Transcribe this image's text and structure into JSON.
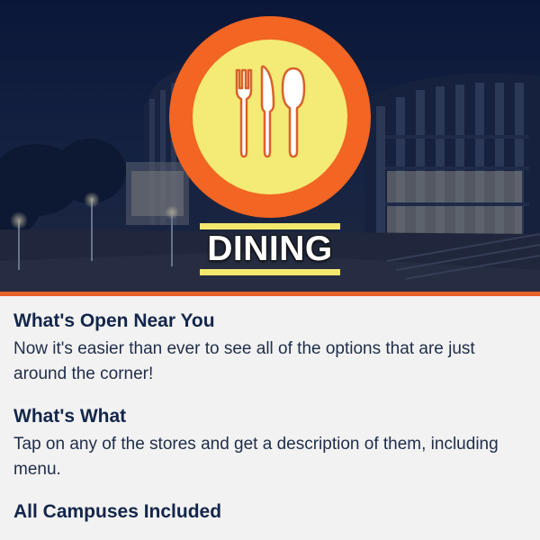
{
  "hero": {
    "title": "DINING",
    "logo_icon": "fork-knife-spoon-icon",
    "colors": {
      "ring": "#f26522",
      "disc": "#f4ea76",
      "title_bar": "#f2e86d",
      "accent_line": "#e8622a"
    }
  },
  "features": [
    {
      "heading": "What's Open Near You",
      "body": "Now it's easier than ever to see all of the options that are just around the corner!"
    },
    {
      "heading": "What's What",
      "body": "Tap on any of the stores and get a description of them, including menu."
    },
    {
      "heading": "All Campuses Included",
      "body": ""
    }
  ]
}
